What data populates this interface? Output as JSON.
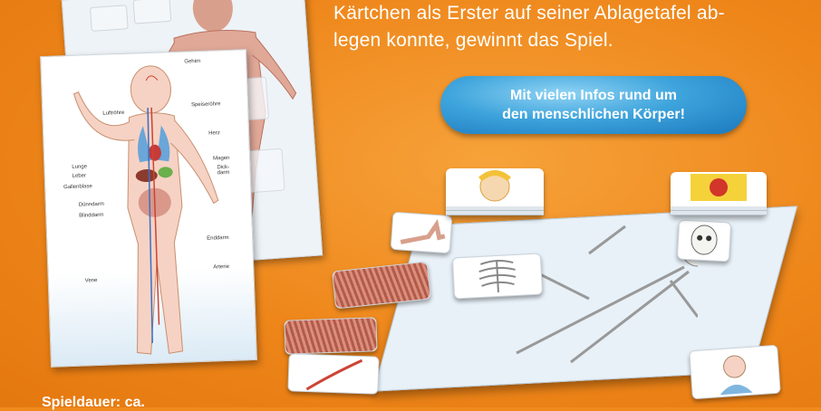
{
  "intro_text": {
    "line1": "Kärtchen als Erster auf seiner Ablagetafel ab-",
    "line2": "legen konnte, gewinnt das Spiel."
  },
  "promo_bubble": {
    "line1": "Mit vielen Infos rund um",
    "line2": "den menschlichen Körper!"
  },
  "anatomy_labels": {
    "gehirn": "Gehirn",
    "luftroehre": "Luftröhre",
    "speiseroehre": "Speiseröhre",
    "herz": "Herz",
    "lunge": "Lunge",
    "leber": "Leber",
    "gallenblase": "Gallenblase",
    "magen": "Magen",
    "dickdarm": "Dick-\ndarm",
    "duenndarm": "Dünndarm",
    "blinddarm": "Blinddarm",
    "enddarm": "Enddarm",
    "arterie": "Arterie",
    "vene": "Vene"
  },
  "footer_partial": "Spieldauer: ca."
}
